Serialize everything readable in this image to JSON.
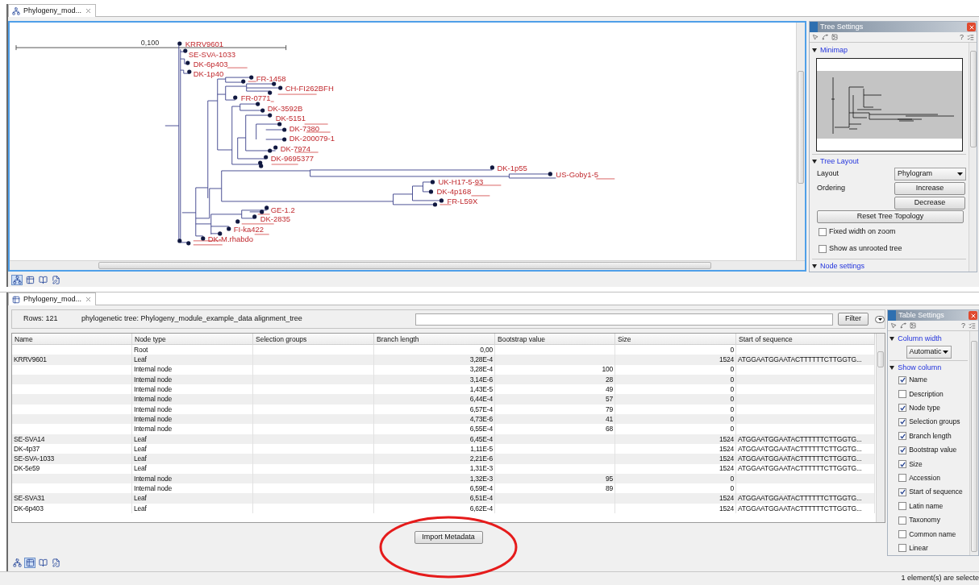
{
  "tree_editor": {
    "tab": {
      "label": "Phylogeny_mod..."
    },
    "tree": {
      "scale_label": "0,100",
      "leaves": [
        "KRRV9601",
        "SE-SVA-1033",
        "DK-6p403",
        "DK-1p40",
        "FR-1458",
        "CH-FI262BFH",
        "FR-0771",
        "DK-3592B",
        "DK-5151",
        "DK-7380",
        "DK-200079-1",
        "DK-7974",
        "DK-9695377",
        "DK-1p55",
        "US-Goby1-5",
        "UK-H17-5-93",
        "DK-4p168",
        "FR-L59X",
        "GE-1.2",
        "DK-2835",
        "FI-ka422",
        "DK-M.rhabdo"
      ]
    },
    "view_buttons": [
      {
        "kind": "tree",
        "selected": true
      },
      {
        "kind": "table",
        "selected": false
      },
      {
        "kind": "text",
        "selected": false
      },
      {
        "kind": "history",
        "selected": false
      }
    ]
  },
  "tree_settings": {
    "title": "Tree Settings",
    "help": "?",
    "sections": [
      {
        "kind": "minimap",
        "title": "Minimap",
        "expanded": true
      },
      {
        "kind": "layout",
        "title": "Tree Layout",
        "expanded": true,
        "layout_label": "Layout",
        "layout_value": "Phylogram",
        "ordering_label": "Ordering",
        "ordering_buttons": [
          "Increase",
          "Decrease"
        ],
        "reset_button": "Reset Tree Topology",
        "options": [
          {
            "label": "Fixed width on zoom",
            "checked": false
          },
          {
            "label": "Show as unrooted tree",
            "checked": false
          }
        ]
      },
      {
        "kind": "node",
        "title": "Node settings",
        "expanded": true
      }
    ]
  },
  "table_editor": {
    "tab": {
      "label": "Phylogeny_mod..."
    },
    "rows_label": "Rows: 121",
    "description": "phylogenetic tree: Phylogeny_module_example_data alignment_tree",
    "filter_button": "Filter",
    "table": {
      "columns": [
        {
          "label": "Name",
          "kind": "text"
        },
        {
          "label": "Node type",
          "kind": "text"
        },
        {
          "label": "Selection groups",
          "kind": "text"
        },
        {
          "label": "Branch length",
          "kind": "number"
        },
        {
          "label": "Bootstrap value",
          "kind": "number"
        },
        {
          "label": "Size",
          "kind": "number"
        },
        {
          "label": "Start of sequence",
          "kind": "text"
        }
      ],
      "rows": [
        [
          "",
          "Root",
          "",
          "0,00",
          "",
          "0",
          ""
        ],
        [
          "KRRV9601",
          "Leaf",
          "",
          "3,28E-4",
          "",
          "1524",
          "ATGGAATGGAATACTTTTTTCTTGGTG..."
        ],
        [
          "",
          "Internal node",
          "",
          "3,28E-4",
          "100",
          "0",
          ""
        ],
        [
          "",
          "Internal node",
          "",
          "3,14E-6",
          "28",
          "0",
          ""
        ],
        [
          "",
          "Internal node",
          "",
          "1,43E-5",
          "49",
          "0",
          ""
        ],
        [
          "",
          "Internal node",
          "",
          "6,44E-4",
          "57",
          "0",
          ""
        ],
        [
          "",
          "Internal node",
          "",
          "6,57E-4",
          "79",
          "0",
          ""
        ],
        [
          "",
          "Internal node",
          "",
          "4,73E-6",
          "41",
          "0",
          ""
        ],
        [
          "",
          "Internal node",
          "",
          "6,55E-4",
          "68",
          "0",
          ""
        ],
        [
          "SE-SVA14",
          "Leaf",
          "",
          "6,45E-4",
          "",
          "1524",
          "ATGGAATGGAATACTTTTTTCTTGGTG..."
        ],
        [
          "DK-4p37",
          "Leaf",
          "",
          "1,11E-5",
          "",
          "1524",
          "ATGGAATGGAATACTTTTTTCTTGGTG..."
        ],
        [
          "SE-SVA-1033",
          "Leaf",
          "",
          "2,21E-6",
          "",
          "1524",
          "ATGGAATGGAATACTTTTTTCTTGGTG..."
        ],
        [
          "DK-5e59",
          "Leaf",
          "",
          "1,31E-3",
          "",
          "1524",
          "ATGGAATGGAATACTTTTTTCTTGGTG..."
        ],
        [
          "",
          "Internal node",
          "",
          "1,32E-3",
          "95",
          "0",
          ""
        ],
        [
          "",
          "Internal node",
          "",
          "6,59E-4",
          "89",
          "0",
          ""
        ],
        [
          "SE-SVA31",
          "Leaf",
          "",
          "6,51E-4",
          "",
          "1524",
          "ATGGAATGGAATACTTTTTTCTTGGTG..."
        ],
        [
          "DK-6p403",
          "Leaf",
          "",
          "6,62E-4",
          "",
          "1524",
          "ATGGAATGGAATACTTTTTTCTTGGTG..."
        ]
      ]
    },
    "import_button": "Import Metadata",
    "view_buttons": [
      {
        "kind": "tree",
        "selected": false
      },
      {
        "kind": "table",
        "selected": true
      },
      {
        "kind": "text",
        "selected": false
      },
      {
        "kind": "history",
        "selected": false
      }
    ]
  },
  "table_settings": {
    "title": "Table Settings",
    "help": "?",
    "column_width": {
      "title": "Column width",
      "expanded": true,
      "value": "Automatic"
    },
    "show_column": {
      "title": "Show column",
      "expanded": true,
      "items": [
        {
          "label": "Name",
          "checked": true
        },
        {
          "label": "Description",
          "checked": false
        },
        {
          "label": "Node type",
          "checked": true
        },
        {
          "label": "Selection groups",
          "checked": true
        },
        {
          "label": "Branch length",
          "checked": true
        },
        {
          "label": "Bootstrap value",
          "checked": true
        },
        {
          "label": "Size",
          "checked": true
        },
        {
          "label": "Accession",
          "checked": false
        },
        {
          "label": "Start of sequence",
          "checked": true
        },
        {
          "label": "Latin name",
          "checked": false
        },
        {
          "label": "Taxonomy",
          "checked": false
        },
        {
          "label": "Common name",
          "checked": false
        },
        {
          "label": "Linear",
          "checked": false
        }
      ]
    }
  },
  "status_bar": {
    "text": "1 element(s) are selecte"
  }
}
